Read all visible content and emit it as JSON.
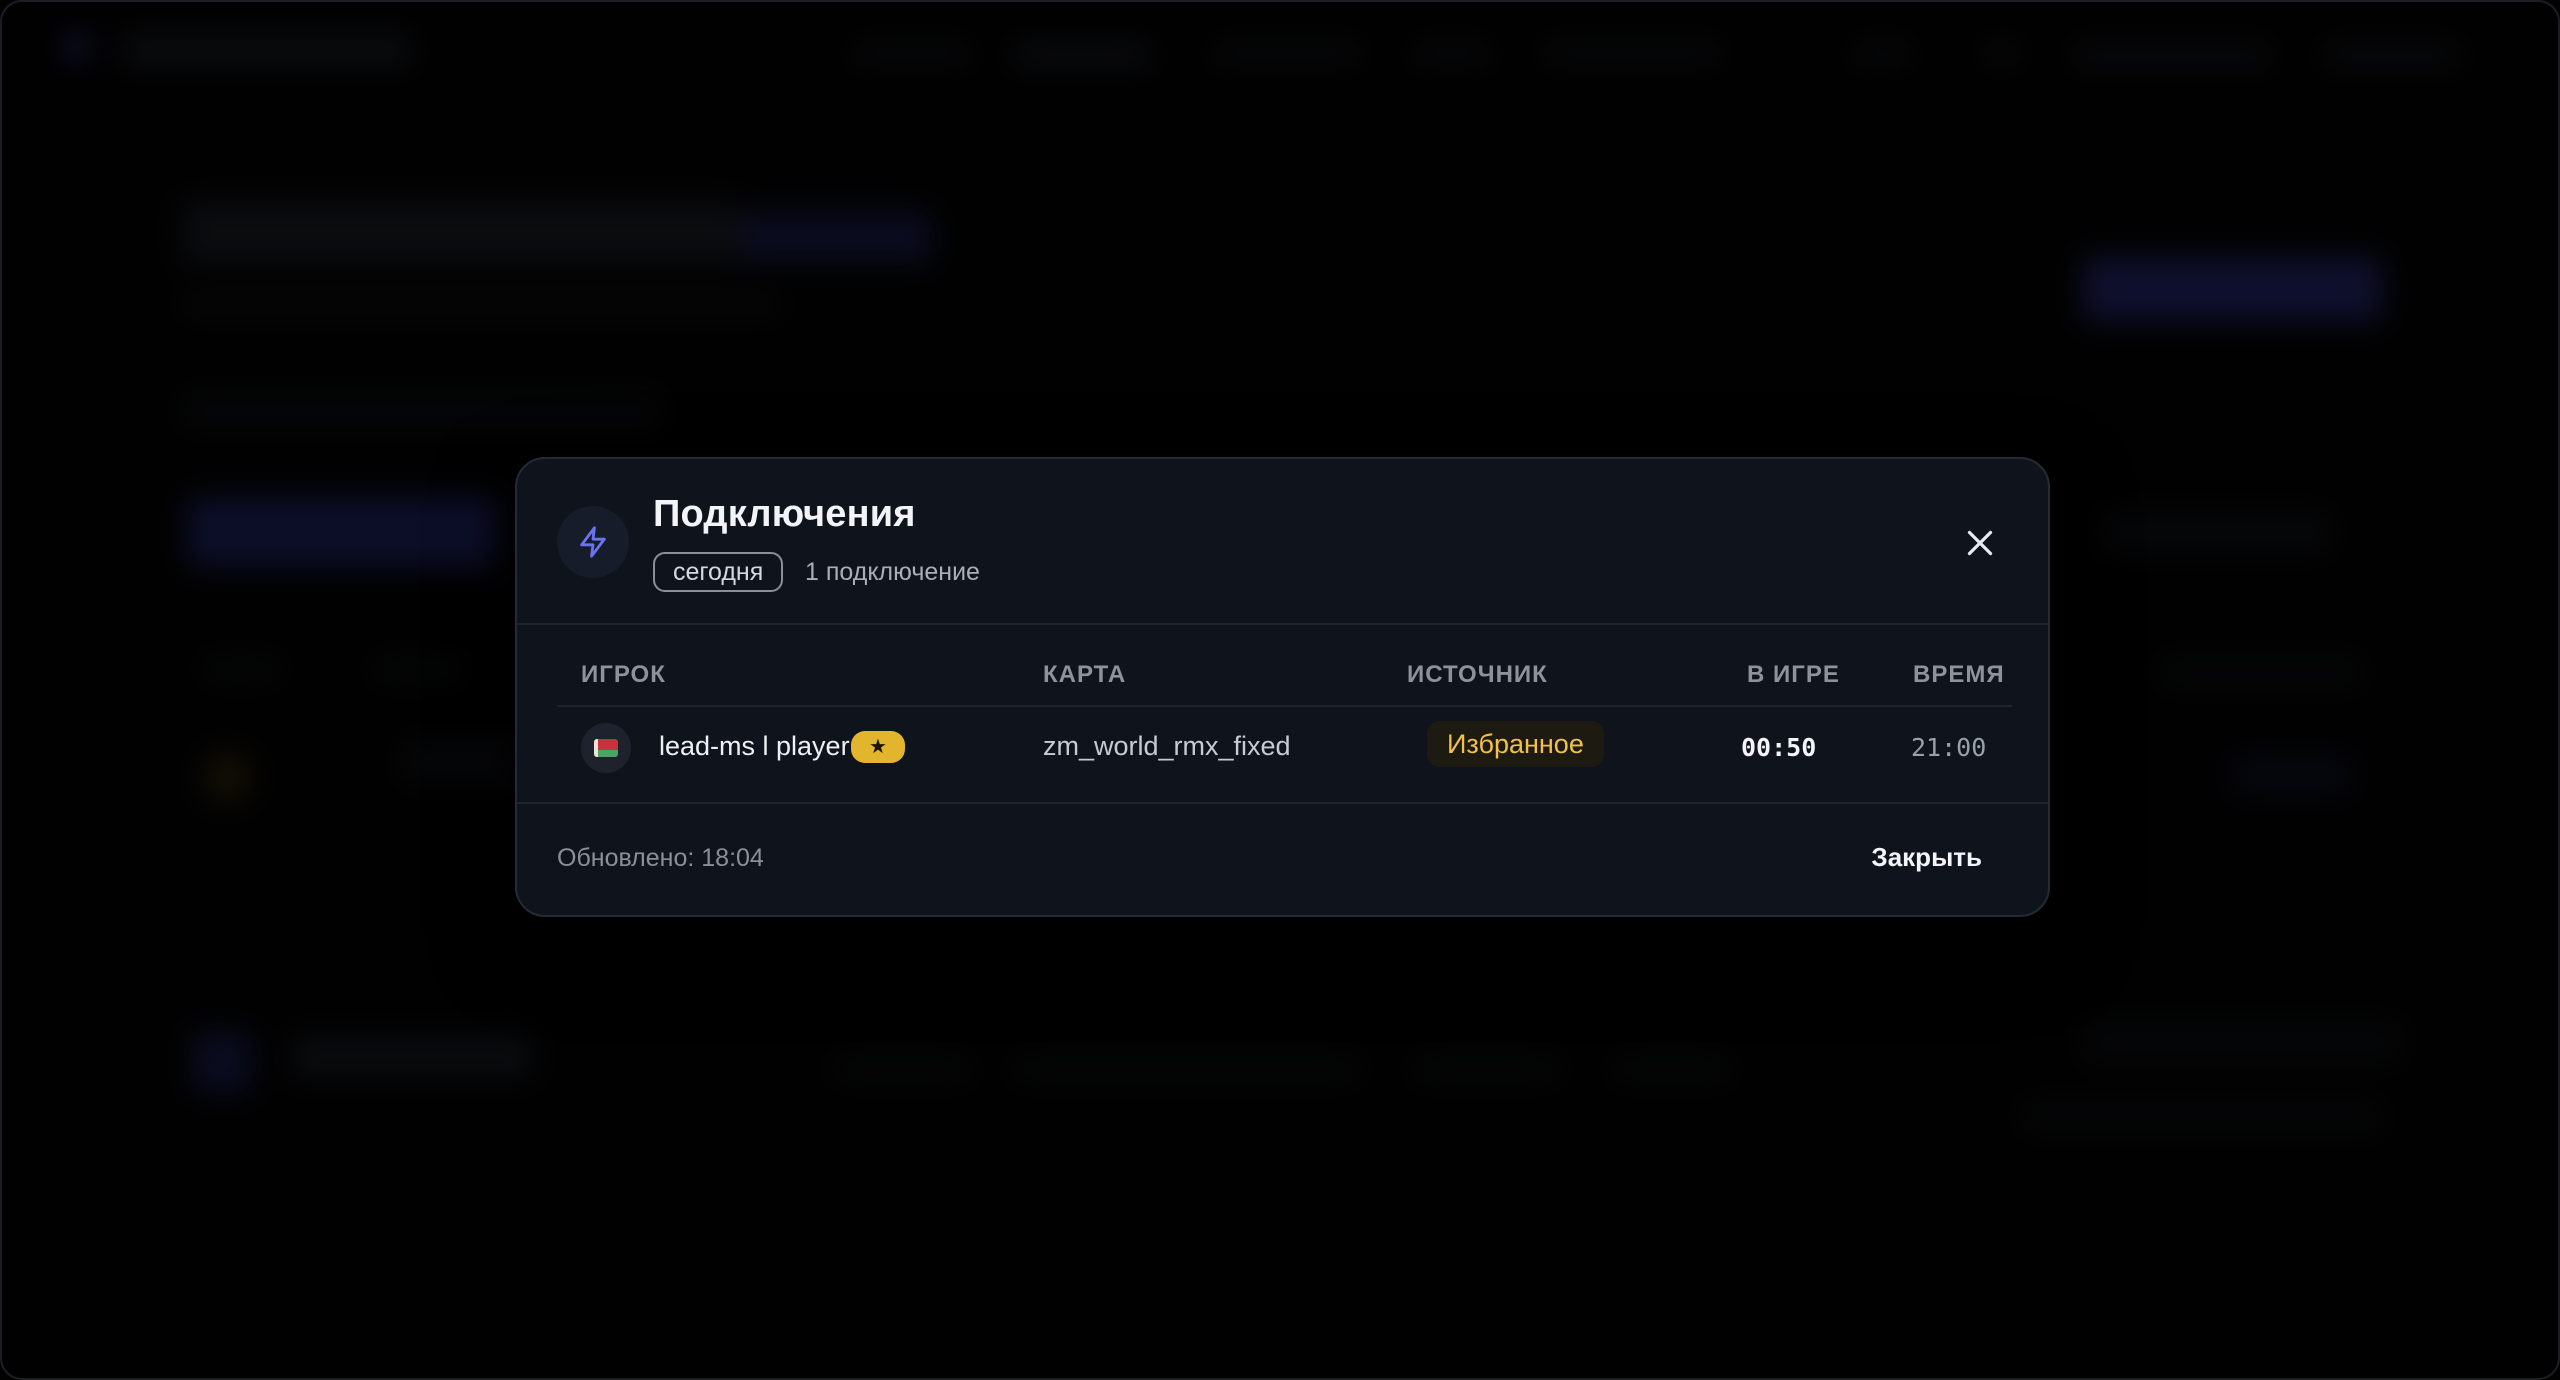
{
  "modal": {
    "title": "Подключения",
    "filter_pill": "сегодня",
    "count_text": "1 подключение",
    "icon": "bolt-icon",
    "close_icon": "close-icon",
    "columns": [
      "ИГРОК",
      "КАРТА",
      "ИСТОЧНИК",
      "В ИГРЕ",
      "ВРЕМЯ"
    ],
    "rows": [
      {
        "flag": "belarus-flag-icon",
        "player": "lead-ms l player",
        "badge": "★",
        "map": "zm_world_rmx_fixed",
        "source": "Избранное",
        "in_game": "00:50",
        "time": "21:00"
      }
    ],
    "updated": "Обновлено: 18:04",
    "close_label": "Закрыть"
  },
  "colors": {
    "accent": "#5b63e6",
    "badge": "#e3b52f",
    "source_text": "#f2c14a",
    "modal_bg": "#0f141c"
  }
}
